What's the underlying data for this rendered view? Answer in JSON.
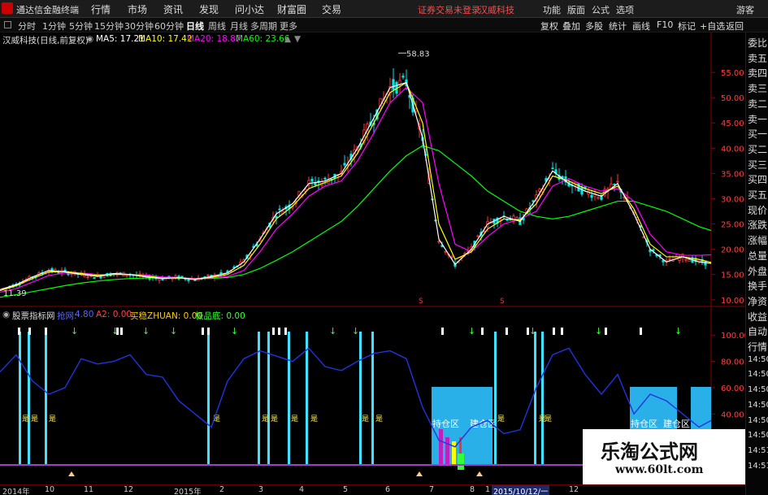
{
  "app": {
    "title": "通达信金融终端",
    "menu": [
      "行情",
      "市场",
      "资讯",
      "发现",
      "问小达",
      "财富圈",
      "交易"
    ],
    "notice": "证券交易未登录",
    "stock_tag": "汉威科技",
    "right_menu": [
      "功能",
      "版面",
      "公式",
      "选项"
    ],
    "guest": "游客"
  },
  "periods": [
    "分时",
    "1分钟",
    "5分钟",
    "15分钟",
    "30分钟",
    "60分钟",
    "日线",
    "周线",
    "月线",
    "多周期",
    "更多"
  ],
  "active_period": "日线",
  "toolbar_buttons": [
    "复权",
    "叠加",
    "多股",
    "统计",
    "画线",
    "F10",
    "标记",
    "+自选",
    "返回"
  ],
  "main_info": {
    "stock": "汉威科技(日线,前复权)",
    "ma5": "MA5: 17.21",
    "ma10": "MA10: 17.42",
    "ma20": "MA20: 18.87",
    "ma60": "MA60: 23.66",
    "colors": {
      "ma5": "#ffffff",
      "ma10": "#ffff00",
      "ma20": "#ff00ff",
      "ma60": "#00ff00"
    }
  },
  "price_labels": {
    "high": "58.83",
    "low": "11.39"
  },
  "sub_info": {
    "name": "股票指标网",
    "a1_label": "抢网:",
    "a1_value": "4.80",
    "a2": "A2: 0.00",
    "zhuan": "买稳ZHUAN: 0.00",
    "diji": "极品底: 0.00"
  },
  "zones": {
    "build": "建仓区",
    "hold": "持仓区"
  },
  "bar_marker": "是",
  "right_panel": [
    "委比",
    "卖五",
    "卖四",
    "卖三",
    "卖二",
    "卖一",
    "买一",
    "买二",
    "买三",
    "买四",
    "买五",
    "现价",
    "涨跌",
    "涨幅",
    "总量",
    "外盘",
    "换手",
    "净资",
    "收益",
    "自动",
    "行情",
    "14:50",
    "14:50",
    "14:50",
    "14:50",
    "14:50",
    "14:50",
    "14:51",
    "14:51"
  ],
  "time_axis": [
    "2014年",
    "10",
    "11",
    "12",
    "2015年",
    "2",
    "3",
    "4",
    "5",
    "6",
    "7",
    "8",
    "1",
    "2015/10/12/一",
    "12"
  ],
  "watermark": {
    "line1": "乐淘公式网",
    "line2": "www.60lt.com"
  },
  "chart_data": [
    {
      "type": "line",
      "title": "汉威科技(日线,前复权)",
      "ylim": [
        9,
        60
      ],
      "y_ticks": [
        10,
        15,
        20,
        25,
        30,
        35,
        40,
        45,
        50,
        55
      ],
      "x": [
        0,
        20,
        40,
        60,
        80,
        100,
        120,
        140,
        160,
        180,
        200,
        220,
        240,
        260,
        280,
        300,
        320,
        340,
        360,
        380,
        400,
        420,
        440,
        460,
        480,
        500,
        520,
        540,
        560,
        580,
        600,
        620,
        640,
        660,
        680,
        700,
        720,
        740,
        760,
        780,
        800,
        820,
        840,
        860,
        875
      ],
      "series": [
        {
          "name": "MA5",
          "color": "#ffffff",
          "values": [
            12.0,
            13.0,
            14.5,
            15.8,
            15.5,
            15.0,
            14.6,
            15.2,
            15.0,
            14.5,
            14.2,
            14.4,
            14.0,
            14.6,
            15.3,
            17.5,
            22.0,
            27.0,
            29.0,
            33.0,
            33.5,
            35.0,
            40.0,
            46.0,
            52.0,
            53.0,
            42.0,
            22.0,
            17.0,
            20.0,
            25.0,
            26.5,
            25.5,
            30.0,
            35.5,
            33.0,
            31.5,
            30.5,
            33.0,
            27.0,
            20.0,
            17.5,
            18.5,
            17.5,
            17.2
          ]
        },
        {
          "name": "MA10",
          "color": "#ffff00",
          "values": [
            11.8,
            12.8,
            14.2,
            15.5,
            15.6,
            15.2,
            14.8,
            15.0,
            15.0,
            14.7,
            14.3,
            14.3,
            14.1,
            14.4,
            15.0,
            16.8,
            21.0,
            26.0,
            28.5,
            32.0,
            33.2,
            34.5,
            39.0,
            45.0,
            51.0,
            53.0,
            45.0,
            25.0,
            18.0,
            19.5,
            24.0,
            26.0,
            25.8,
            29.0,
            34.5,
            33.5,
            32.0,
            31.0,
            32.5,
            28.0,
            21.0,
            18.5,
            18.5,
            18.0,
            17.4
          ]
        },
        {
          "name": "MA20",
          "color": "#ff00ff",
          "values": [
            11.5,
            12.2,
            13.5,
            14.8,
            15.3,
            15.3,
            15.0,
            15.0,
            15.0,
            14.9,
            14.5,
            14.4,
            14.2,
            14.3,
            14.6,
            15.8,
            19.5,
            24.0,
            27.0,
            30.5,
            32.5,
            33.5,
            37.5,
            43.0,
            49.0,
            52.0,
            49.0,
            33.0,
            21.0,
            19.5,
            22.5,
            25.0,
            26.0,
            27.5,
            32.5,
            34.0,
            32.5,
            31.5,
            32.0,
            29.5,
            23.0,
            19.5,
            18.8,
            18.8,
            18.9
          ]
        },
        {
          "name": "MA60",
          "color": "#00ff00",
          "values": [
            10.5,
            11.0,
            11.6,
            12.2,
            12.8,
            13.3,
            13.7,
            14.0,
            14.2,
            14.3,
            14.3,
            14.3,
            14.2,
            14.2,
            14.4,
            15.0,
            16.2,
            17.8,
            19.5,
            21.5,
            23.5,
            25.5,
            28.5,
            32.0,
            35.5,
            38.5,
            40.5,
            39.5,
            37.0,
            34.5,
            31.5,
            29.5,
            27.5,
            26.5,
            26.0,
            26.5,
            27.5,
            28.5,
            29.5,
            29.5,
            28.5,
            27.5,
            26.0,
            24.5,
            23.7
          ]
        }
      ]
    },
    {
      "type": "line",
      "title": "股票指标网",
      "ylim": [
        0,
        110
      ],
      "y_ticks": [
        40,
        60,
        80,
        100
      ],
      "x": [
        0,
        20,
        40,
        60,
        80,
        100,
        120,
        140,
        160,
        180,
        200,
        220,
        240,
        260,
        280,
        300,
        320,
        340,
        360,
        380,
        400,
        420,
        440,
        460,
        480,
        500,
        520,
        540,
        560,
        580,
        600,
        620,
        640,
        660,
        680,
        700,
        720,
        740,
        760,
        780,
        800,
        820,
        840,
        860,
        875
      ],
      "series": [
        {
          "name": "抢网",
          "color": "#2233dd",
          "values": [
            72,
            85,
            65,
            55,
            60,
            82,
            78,
            80,
            85,
            70,
            68,
            50,
            40,
            30,
            65,
            82,
            88,
            84,
            80,
            90,
            76,
            73,
            80,
            86,
            88,
            82,
            45,
            20,
            15,
            30,
            35,
            25,
            28,
            60,
            85,
            90,
            70,
            55,
            70,
            40,
            55,
            50,
            40,
            30,
            35
          ]
        }
      ]
    }
  ]
}
